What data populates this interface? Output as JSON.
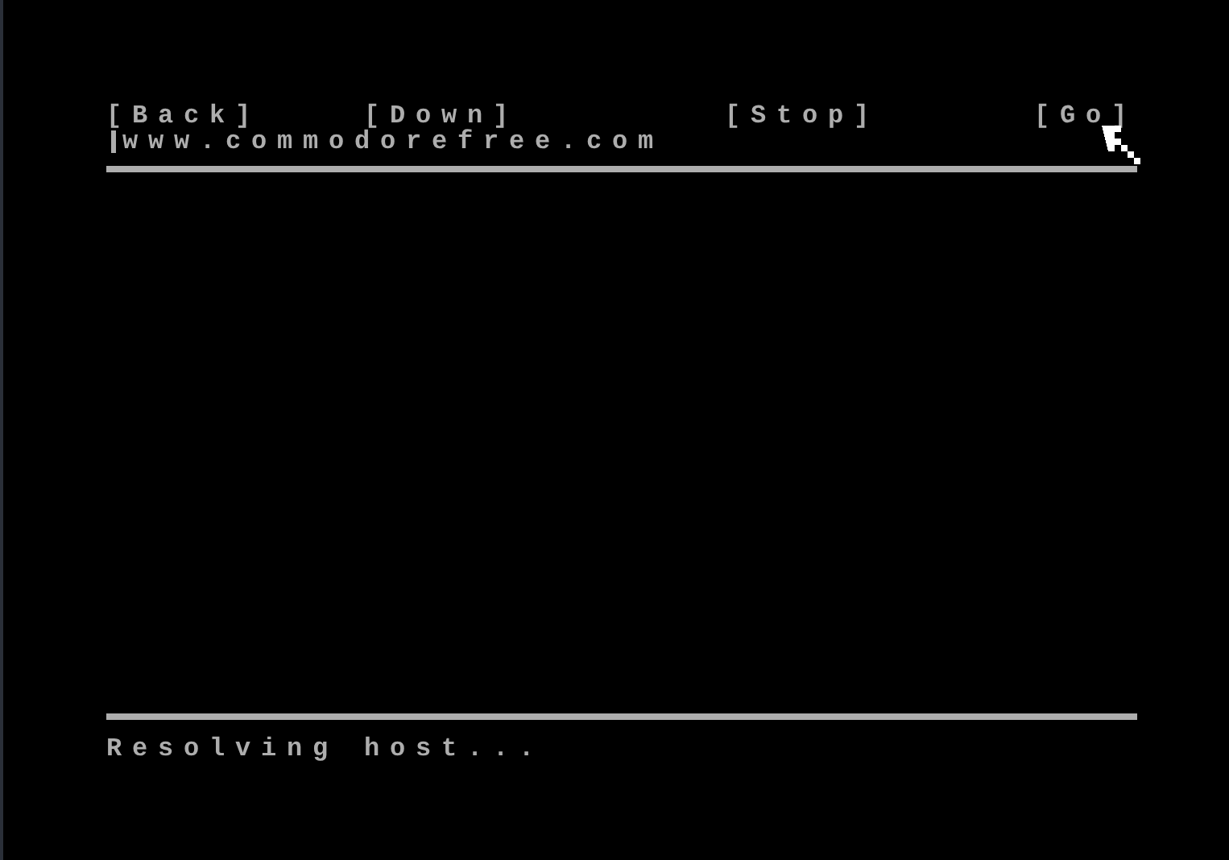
{
  "toolbar": {
    "buttons": [
      {
        "label": "[Back]"
      },
      {
        "label": "[Down]"
      },
      {
        "label": "[Stop]"
      },
      {
        "label": "[Go]"
      }
    ]
  },
  "address_bar": {
    "value": "www.commodorefree.com"
  },
  "status_bar": {
    "text": "Resolving host..."
  }
}
